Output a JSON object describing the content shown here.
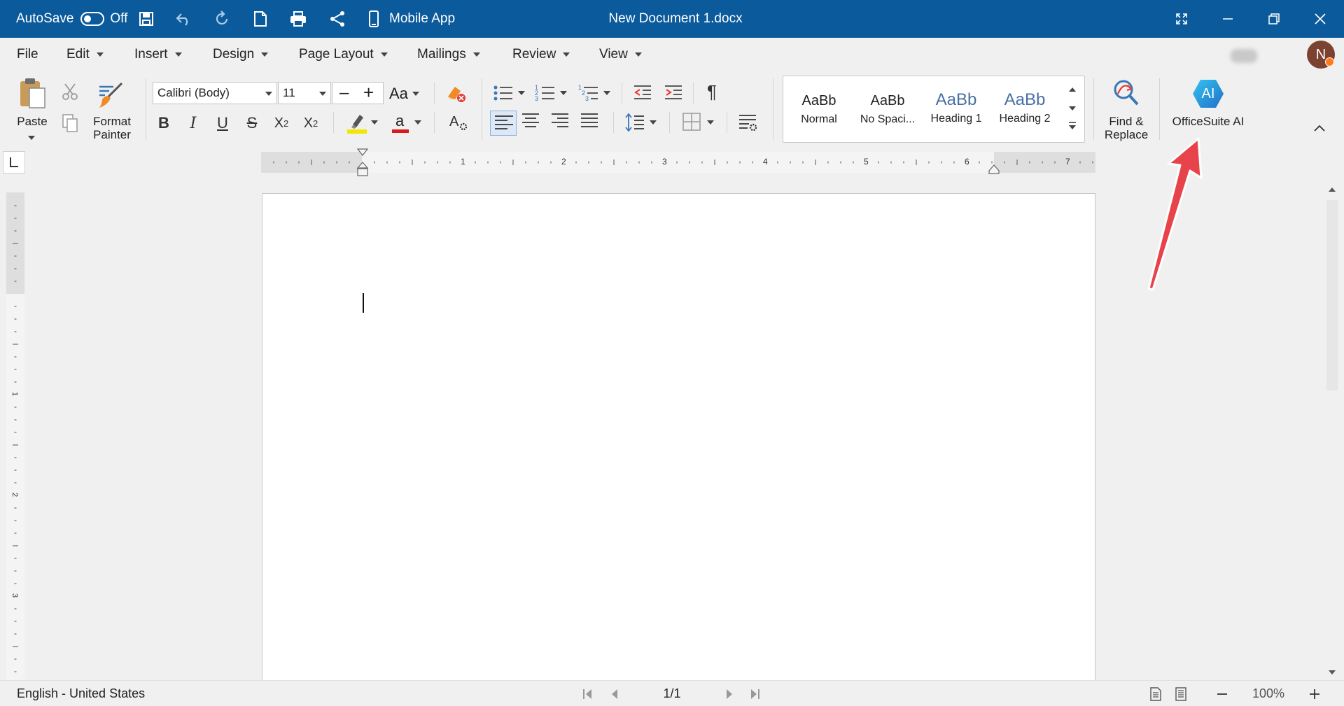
{
  "titlebar": {
    "autosave_label": "AutoSave",
    "autosave_state": "Off",
    "mobile_app_label": "Mobile App",
    "document_title": "New Document 1.docx"
  },
  "menubar": {
    "items": [
      "File",
      "Edit",
      "Insert",
      "Design",
      "Page Layout",
      "Mailings",
      "Review",
      "View"
    ],
    "avatar_initial": "N"
  },
  "ribbon": {
    "paste_label": "Paste",
    "format_painter_label": "Format\nPainter",
    "font_name": "Calibri (Body)",
    "font_size": "11",
    "case_label": "Aa",
    "styles": [
      {
        "sample": "AaBb",
        "name": "Normal"
      },
      {
        "sample": "AaBb",
        "name": "No Spaci..."
      },
      {
        "sample": "AaBb",
        "name": "Heading 1"
      },
      {
        "sample": "AaBb",
        "name": "Heading 2"
      }
    ],
    "find_replace_label": "Find &\nReplace",
    "ai_label": "OfficeSuite AI",
    "ai_icon_text": "AI"
  },
  "ruler": {
    "marks": [
      "1",
      "2",
      "3",
      "4",
      "5",
      "6",
      "7"
    ],
    "vertical_marks": [
      "1",
      "2",
      "3"
    ]
  },
  "statusbar": {
    "language": "English - United States",
    "page_indicator": "1/1",
    "zoom": "100%"
  },
  "colors": {
    "title_bar": "#0b5a9c",
    "highlight": "#f3e600",
    "font_color": "#d81b1b",
    "arrow": "#e8434a"
  }
}
